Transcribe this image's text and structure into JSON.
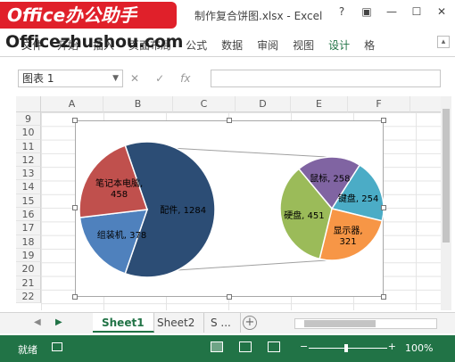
{
  "window": {
    "watermark": "Office办公助手",
    "site": "Officezhushou.com",
    "title": "制作复合饼图.xlsx - Excel",
    "controls": [
      "?",
      "▣",
      "—",
      "☐",
      "✕"
    ]
  },
  "ribbon": {
    "tabs": [
      "文件",
      "开始",
      "插入",
      "页面布局",
      "公式",
      "数据",
      "审阅",
      "视图",
      "设计",
      "格"
    ],
    "active_tab": "设计"
  },
  "formula_bar": {
    "name_box": "图表 1",
    "cancel": "✕",
    "enter": "✓",
    "fx": "fx",
    "formula": ""
  },
  "grid": {
    "columns": [
      "A",
      "B",
      "C",
      "D",
      "E",
      "F"
    ],
    "rows": [
      "9",
      "10",
      "11",
      "12",
      "13",
      "14",
      "15",
      "16",
      "17",
      "18",
      "19",
      "20",
      "21",
      "22"
    ]
  },
  "chart_data": {
    "type": "pie",
    "subtype": "pie-of-pie",
    "primary": [
      {
        "label": "笔记本电脑",
        "value": 458,
        "color": "#c0504d"
      },
      {
        "label": "组装机",
        "value": 378,
        "color": "#4f81bd"
      },
      {
        "label": "配件",
        "value": 1284,
        "color": "#2c4d75"
      }
    ],
    "secondary": [
      {
        "label": "鼠标",
        "value": 258,
        "color": "#8064a2"
      },
      {
        "label": "键盘",
        "value": 254,
        "color": "#4bacc6"
      },
      {
        "label": "显示器",
        "value": 321,
        "color": "#f79646"
      },
      {
        "label": "硬盘",
        "value": 451,
        "color": "#9bbb59"
      }
    ],
    "data_labels": [
      {
        "text": "笔记本电脑,",
        "text2": "458"
      },
      {
        "text": "组装机, 378"
      },
      {
        "text": "配件, 1284"
      },
      {
        "text": "鼠标, 258"
      },
      {
        "text": "键盘, 254"
      },
      {
        "text": "显示器,",
        "text2": "321"
      },
      {
        "text": "硬盘, 451"
      }
    ]
  },
  "sheets": {
    "tabs": [
      "Sheet1",
      "Sheet2",
      "S ..."
    ],
    "active": "Sheet1",
    "add": "+"
  },
  "status": {
    "ready": "就绪",
    "zoom": "100%",
    "minus": "−",
    "plus": "+"
  }
}
